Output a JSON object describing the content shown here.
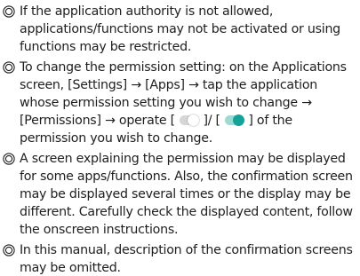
{
  "notes": [
    {
      "text": "If the application authority is not allowed, applications/functions may not be activated or using functions may be restricted."
    },
    {
      "part1": "To change the permission setting: on the Applications screen, [Settings] → [Apps] → tap the application whose permission setting you wish to change → [Permissions] → operate [ ",
      "part2": " ]/ [ ",
      "part3": " ] of the permission you wish to change."
    },
    {
      "text": "A screen explaining the permission may be displayed for some apps/functions. Also, the confirmation screen may be displayed several times or the display may be different. Carefully check the displayed content, follow the onscreen instructions."
    },
    {
      "text": "In this manual, description of the confirmation screens may be omitted."
    }
  ],
  "colors": {
    "text": "#1e1e1e",
    "toggle_on_track": "#9fd9d2",
    "toggle_on_knob": "#14a396",
    "toggle_off_track": "#d6d6d6"
  },
  "icons": {
    "bullet": "double-circle-icon",
    "toggle_off": "toggle-off-icon",
    "toggle_on": "toggle-on-icon"
  }
}
